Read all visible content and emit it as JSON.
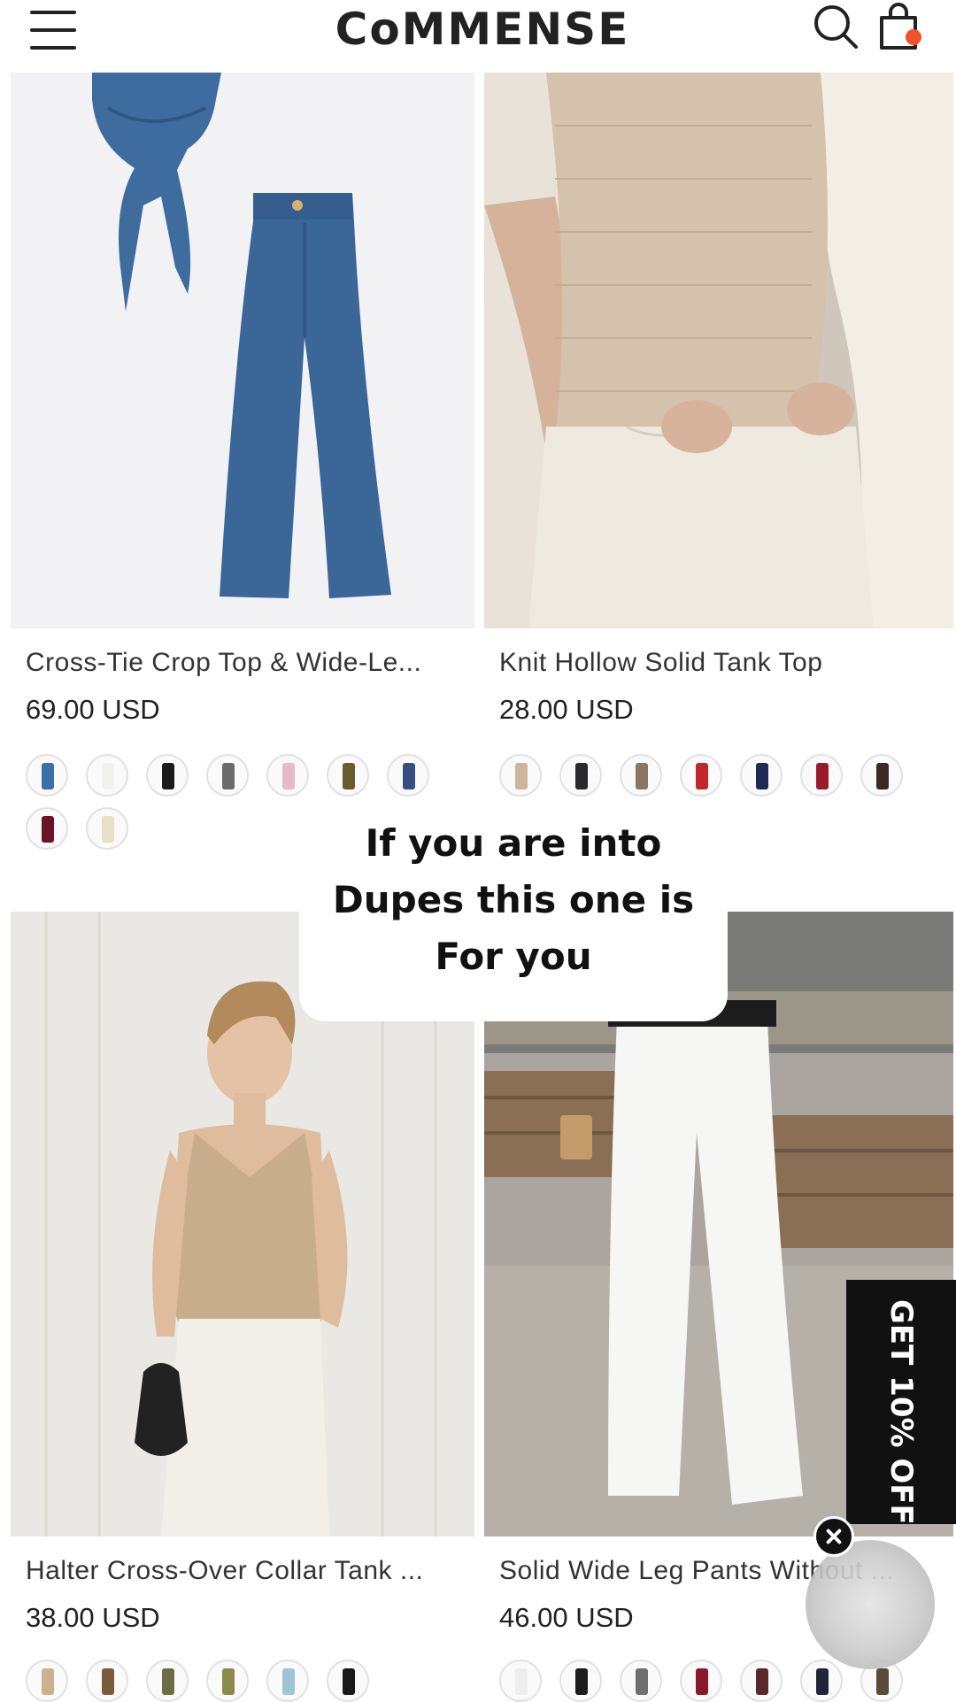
{
  "header": {
    "logo": "CoMMENSE",
    "menu_icon": "hamburger-menu-icon",
    "search_icon": "search-icon",
    "bag_icon": "shopping-bag-icon",
    "bag_dot_color": "#f0532c"
  },
  "products": [
    {
      "title": "Cross-Tie Crop Top & Wide-Le...",
      "price": "69.00 USD",
      "image": "denim crop top and wide-leg jeans",
      "swatch_colors": [
        "#3c6ea8",
        "#f1f1ee",
        "#1b1b1b",
        "#6b6b6b",
        "#e8b9c8",
        "#6a5a30",
        "#35507f",
        "#6b1329",
        "#e7e2c6"
      ]
    },
    {
      "title": "Knit Hollow Solid Tank Top",
      "price": "28.00 USD",
      "image": "beige knit tank top with white trousers",
      "swatch_colors": [
        "#cdb49a",
        "#2a2a2e",
        "#8b7663",
        "#c3262a",
        "#1f2a55",
        "#9b1a2a",
        "#3b2a22"
      ]
    },
    {
      "title": "Halter Cross-Over Collar Tank ...",
      "price": "38.00 USD",
      "image": "woman in beige halter tank and white pants",
      "swatch_colors": [
        "#cdb08e",
        "#7a5a3a",
        "#6b6e44",
        "#8a8a4a",
        "#9ec4d8",
        "#1a1a1a"
      ]
    },
    {
      "title": "Solid Wide Leg Pants Without ...",
      "price": "46.00 USD",
      "image": "white wide leg pants street photo",
      "swatch_colors": [
        "#eeeeee",
        "#1c1c1c",
        "#6f6f6f",
        "#8a1a2a",
        "#5a2a2a",
        "#22243a",
        "#5a4a3a"
      ]
    }
  ],
  "overlay": {
    "lines": [
      "If you are into",
      "Dupes this one is",
      "For you"
    ]
  },
  "promo": {
    "label": "GET 10% OFF"
  }
}
